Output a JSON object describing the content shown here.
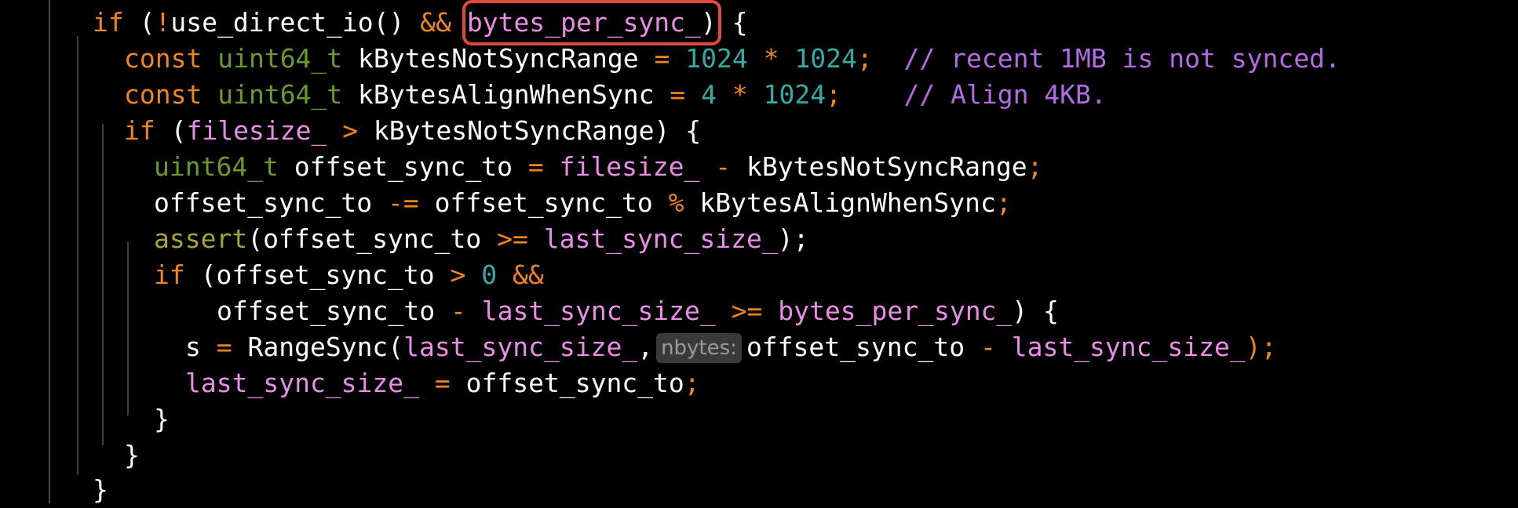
{
  "editor": {
    "lines": [
      {
        "tokens": [
          {
            "t": "if",
            "c": "kw"
          },
          {
            "t": " (",
            "c": "pl"
          },
          {
            "t": "!",
            "c": "op"
          },
          {
            "t": "use_direct_io() ",
            "c": "pl"
          },
          {
            "t": "&&",
            "c": "op"
          },
          {
            "t": " ",
            "c": "pl"
          },
          {
            "t": "bytes_per_sync_",
            "c": "pk",
            "hl": "open"
          },
          {
            "t": ")",
            "c": "pl",
            "hl": "close"
          },
          {
            "t": " {",
            "c": "pl"
          }
        ]
      },
      {
        "tokens": [
          {
            "t": "const",
            "c": "kw"
          },
          {
            "t": " ",
            "c": "pl"
          },
          {
            "t": "uint64_t",
            "c": "ty"
          },
          {
            "t": " kBytesNotSyncRange ",
            "c": "pl"
          },
          {
            "t": "=",
            "c": "op"
          },
          {
            "t": " ",
            "c": "pl"
          },
          {
            "t": "1024",
            "c": "num"
          },
          {
            "t": " ",
            "c": "pl"
          },
          {
            "t": "*",
            "c": "op"
          },
          {
            "t": " ",
            "c": "pl"
          },
          {
            "t": "1024",
            "c": "num"
          },
          {
            "t": ";",
            "c": "op"
          },
          {
            "t": "  ",
            "c": "pl"
          },
          {
            "t": "// recent 1MB is not synced.",
            "c": "cm"
          }
        ]
      },
      {
        "tokens": [
          {
            "t": "const",
            "c": "kw"
          },
          {
            "t": " ",
            "c": "pl"
          },
          {
            "t": "uint64_t",
            "c": "ty"
          },
          {
            "t": " kBytesAlignWhenSync ",
            "c": "pl"
          },
          {
            "t": "=",
            "c": "op"
          },
          {
            "t": " ",
            "c": "pl"
          },
          {
            "t": "4",
            "c": "num"
          },
          {
            "t": " ",
            "c": "pl"
          },
          {
            "t": "*",
            "c": "op"
          },
          {
            "t": " ",
            "c": "pl"
          },
          {
            "t": "1024",
            "c": "num"
          },
          {
            "t": ";",
            "c": "op"
          },
          {
            "t": "    ",
            "c": "pl"
          },
          {
            "t": "// Align 4KB.",
            "c": "cm"
          }
        ]
      },
      {
        "tokens": [
          {
            "t": "if",
            "c": "kw"
          },
          {
            "t": " (",
            "c": "pl"
          },
          {
            "t": "filesize_",
            "c": "pk"
          },
          {
            "t": " ",
            "c": "pl"
          },
          {
            "t": ">",
            "c": "op"
          },
          {
            "t": " kBytesNotSyncRange) {",
            "c": "pl"
          }
        ]
      },
      {
        "tokens": [
          {
            "t": "uint64_t",
            "c": "ty"
          },
          {
            "t": " offset_sync_to ",
            "c": "pl"
          },
          {
            "t": "=",
            "c": "op"
          },
          {
            "t": " ",
            "c": "pl"
          },
          {
            "t": "filesize_",
            "c": "pk"
          },
          {
            "t": " ",
            "c": "pl"
          },
          {
            "t": "-",
            "c": "op"
          },
          {
            "t": " kBytesNotSyncRange",
            "c": "pl"
          },
          {
            "t": ";",
            "c": "op"
          }
        ]
      },
      {
        "tokens": [
          {
            "t": "offset_sync_to ",
            "c": "pl"
          },
          {
            "t": "-=",
            "c": "op"
          },
          {
            "t": " offset_sync_to ",
            "c": "pl"
          },
          {
            "t": "%",
            "c": "op"
          },
          {
            "t": " kBytesAlignWhenSync",
            "c": "pl"
          },
          {
            "t": ";",
            "c": "op"
          }
        ]
      },
      {
        "tokens": [
          {
            "t": "assert",
            "c": "fn"
          },
          {
            "t": "(offset_sync_to ",
            "c": "pl"
          },
          {
            "t": ">=",
            "c": "op"
          },
          {
            "t": " ",
            "c": "pl"
          },
          {
            "t": "last_sync_size_",
            "c": "pk"
          },
          {
            "t": ");",
            "c": "pl"
          }
        ]
      },
      {
        "tokens": [
          {
            "t": "if",
            "c": "kw"
          },
          {
            "t": " (offset_sync_to ",
            "c": "pl"
          },
          {
            "t": ">",
            "c": "op"
          },
          {
            "t": " ",
            "c": "pl"
          },
          {
            "t": "0",
            "c": "num"
          },
          {
            "t": " ",
            "c": "pl"
          },
          {
            "t": "&&",
            "c": "op"
          }
        ]
      },
      {
        "tokens": [
          {
            "t": "offset_sync_to ",
            "c": "pl"
          },
          {
            "t": "-",
            "c": "op"
          },
          {
            "t": " ",
            "c": "pl"
          },
          {
            "t": "last_sync_size_",
            "c": "pk"
          },
          {
            "t": " ",
            "c": "pl"
          },
          {
            "t": ">=",
            "c": "op"
          },
          {
            "t": " ",
            "c": "pl"
          },
          {
            "t": "bytes_per_sync_",
            "c": "pk"
          },
          {
            "t": ") {",
            "c": "pl"
          }
        ]
      },
      {
        "tokens": [
          {
            "t": "s ",
            "c": "pl"
          },
          {
            "t": "=",
            "c": "op"
          },
          {
            "t": " RangeSync(",
            "c": "pl"
          },
          {
            "t": "last_sync_size_",
            "c": "pk"
          },
          {
            "t": ",",
            "c": "pl"
          },
          {
            "t": "nbytes:",
            "c": "hint"
          },
          {
            "t": "offset_sync_to ",
            "c": "pl"
          },
          {
            "t": "-",
            "c": "op"
          },
          {
            "t": " ",
            "c": "pl"
          },
          {
            "t": "last_sync_size_",
            "c": "pk"
          },
          {
            "t": ");",
            "c": "op"
          }
        ]
      },
      {
        "tokens": [
          {
            "t": "last_sync_size_",
            "c": "pk"
          },
          {
            "t": " ",
            "c": "pl"
          },
          {
            "t": "=",
            "c": "op"
          },
          {
            "t": " offset_sync_to",
            "c": "pl"
          },
          {
            "t": ";",
            "c": "op"
          }
        ]
      },
      {
        "tokens": [
          {
            "t": "}",
            "c": "pl"
          }
        ]
      },
      {
        "tokens": [
          {
            "t": "}",
            "c": "pl"
          }
        ]
      },
      {
        "tokens": [
          {
            "t": "}",
            "c": "pl"
          }
        ]
      }
    ]
  }
}
